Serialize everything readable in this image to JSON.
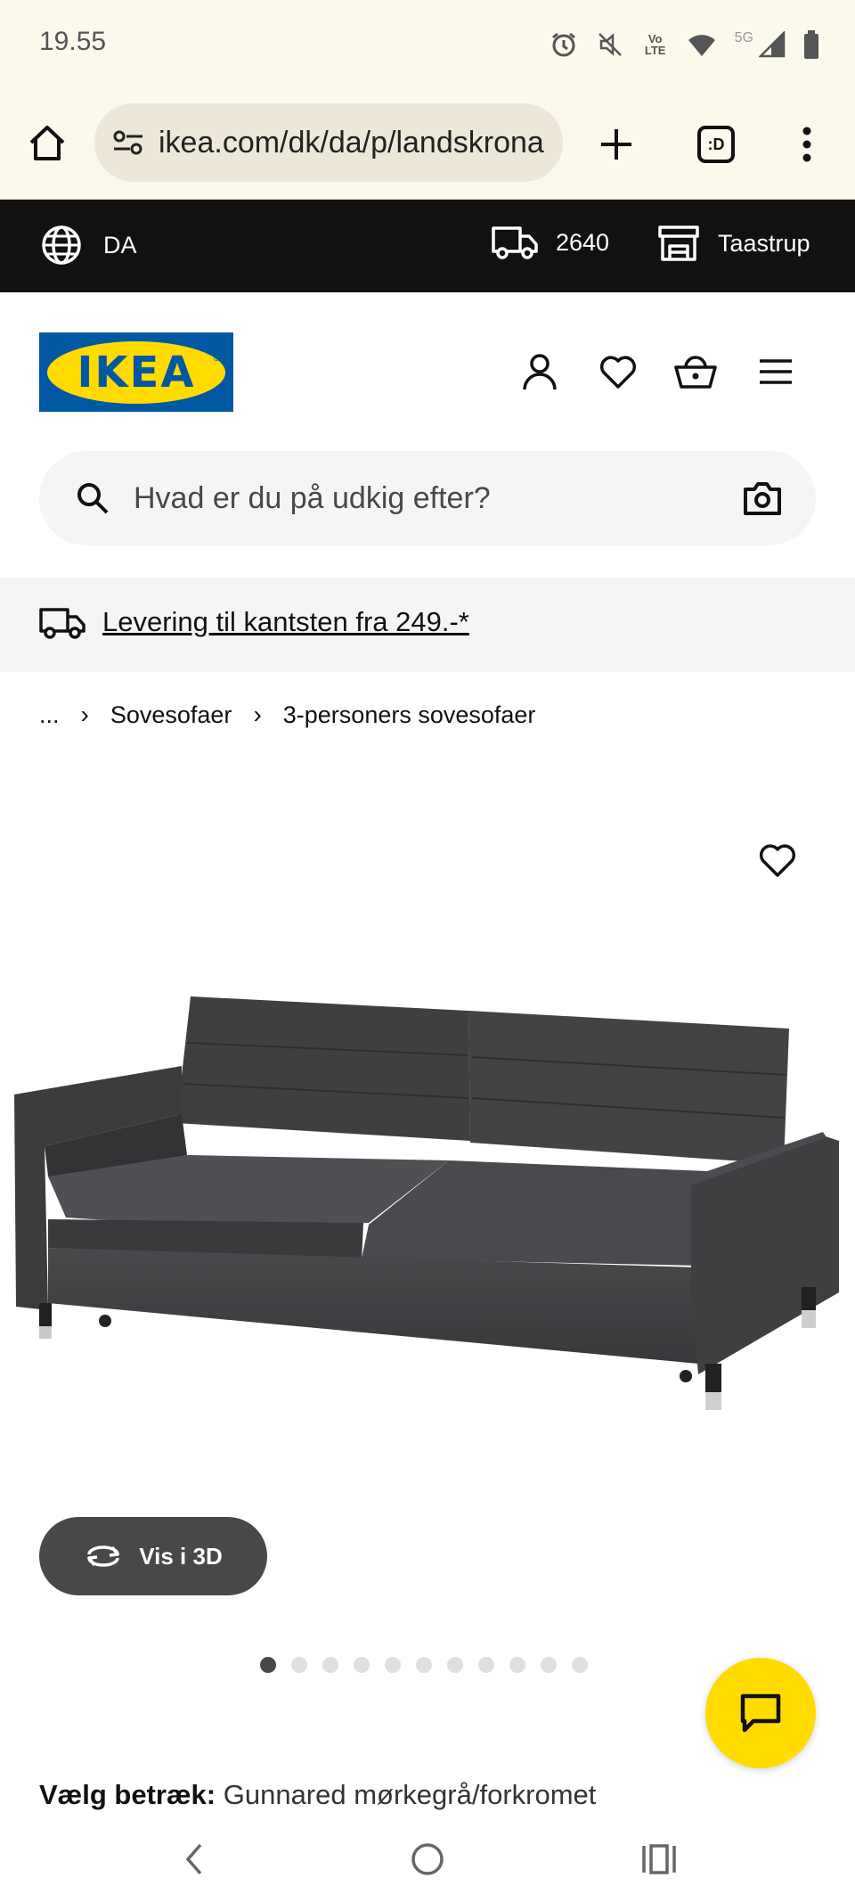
{
  "status": {
    "time": "19.55",
    "network": "5G",
    "volte": "Vo LTE"
  },
  "browser": {
    "url": "ikea.com/dk/da/p/landskrona",
    "tab_badge": ":D"
  },
  "topbar": {
    "language": "DA",
    "zip": "2640",
    "store": "Taastrup"
  },
  "logo": {
    "text": "IKEA",
    "registered": "®"
  },
  "search": {
    "placeholder": "Hvad er du på udkig efter?"
  },
  "delivery": {
    "text": "Levering til kantsten fra 249.-*"
  },
  "breadcrumb": {
    "ellipsis": "...",
    "items": [
      "Sovesofaer",
      "3-personers sovesofaer"
    ],
    "separator": "›"
  },
  "product": {
    "view3d_label": "Vis i 3D",
    "carousel": {
      "total": 11,
      "active": 1
    },
    "fabric_label": "Vælg betræk:",
    "fabric_value": "Gunnared mørkegrå/forkromet"
  },
  "colors": {
    "ikea_blue": "#0058a3",
    "ikea_yellow": "#ffdb00",
    "topbar_bg": "#111111",
    "browser_bg": "#fbf8ec"
  }
}
